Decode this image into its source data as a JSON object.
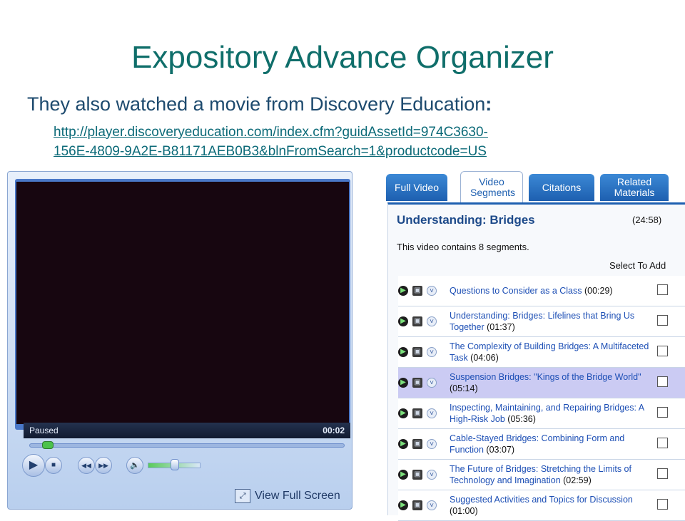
{
  "slide": {
    "title": "Expository Advance Organizer",
    "intro_text": "They also watched a movie from Discovery Education",
    "intro_colon": ":",
    "link_line1": "http://player.discoveryeducation.com/index.cfm?guidAssetId=974C3630-",
    "link_line2": "156E-4809-9A2E-B81171AEB0B3&blnFromSearch=1&productcode=US"
  },
  "player": {
    "status": "Paused",
    "time": "00:02",
    "progress_percent": 4,
    "volume_percent": 45,
    "fullscreen_label": "View Full Screen",
    "icons": {
      "play": "play-icon",
      "stop": "stop-icon",
      "prev": "previous-icon",
      "next": "next-icon",
      "mute": "speaker-icon",
      "fullscreen": "fullscreen-icon"
    }
  },
  "panel": {
    "tabs": [
      {
        "label": "Full Video",
        "active": false
      },
      {
        "label": "Video Segments",
        "active": true
      },
      {
        "label": "Citations",
        "active": false
      },
      {
        "label": "Related Materials",
        "active": false
      }
    ],
    "title": "Understanding: Bridges",
    "length": "(24:58)",
    "segment_count_text": "This video contains 8 segments.",
    "select_label": "Select To Add",
    "segments": [
      {
        "name": "Questions to Consider as a Class",
        "time": "(00:29)"
      },
      {
        "name": "Understanding: Bridges: Lifelines that Bring Us Together",
        "time": "(01:37)"
      },
      {
        "name": "The Complexity of Building Bridges: A Multifaceted Task",
        "time": "(04:06)"
      },
      {
        "name": "Suspension Bridges: \"Kings of the Bridge World\"",
        "time": "(05:14)"
      },
      {
        "name": "Inspecting, Maintaining, and Repairing Bridges: A High-Risk Job",
        "time": "(05:36)"
      },
      {
        "name": "Cable-Stayed Bridges: Combining Form and Function",
        "time": "(03:07)"
      },
      {
        "name": "The Future of Bridges: Stretching the Limits of Technology and Imagination",
        "time": "(02:59)"
      },
      {
        "name": "Suggested Activities and Topics for Discussion",
        "time": "(01:00)"
      }
    ],
    "highlighted_row": 3,
    "row_icons": [
      "play-icon",
      "save-icon",
      "chevron-down-icon"
    ],
    "highlight_color": "#cbcbf3"
  }
}
